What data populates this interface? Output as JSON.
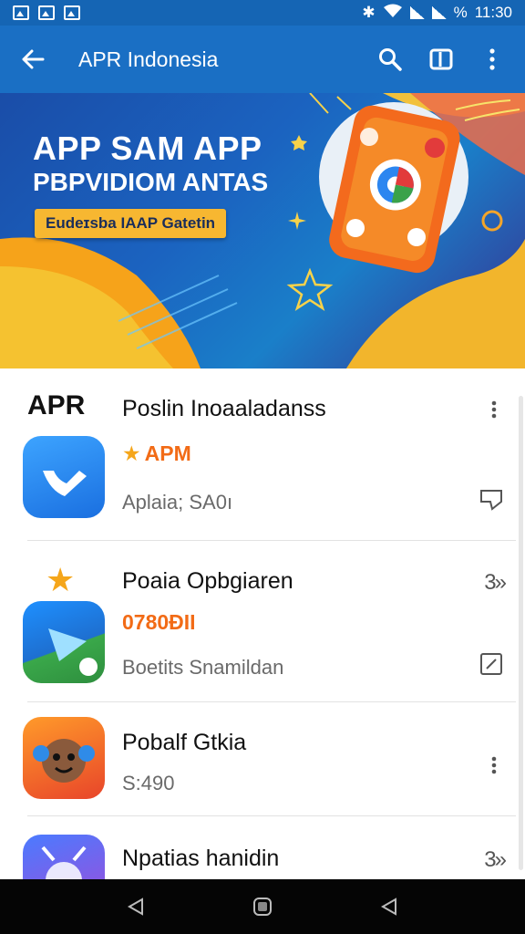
{
  "status_bar": {
    "time": "11:30",
    "battery": "%"
  },
  "app_bar": {
    "title": "APR Indonesia"
  },
  "banner": {
    "headline": "APP SAM APP",
    "subheadline": "PBPVIDIOM ANTAS",
    "badge": "Eudeɪsba IAAP Gatetin"
  },
  "list": {
    "brand_logo": "APR",
    "items": [
      {
        "title": "Poslin Inoaaladanss",
        "accent": "APM",
        "subtitle": "Aplaia; SA0ı"
      },
      {
        "title": "Poaia Opbgiaren",
        "accent": "0780ĐII",
        "subtitle": "Boetits Snamildan",
        "chevron": "3»"
      },
      {
        "title": "Pobalf Gtkia",
        "subtitle": "S:490"
      },
      {
        "title": "Npatias hanidin",
        "chevron": "3»"
      }
    ]
  },
  "colors": {
    "app_bar": "#1a6fc4",
    "status_bar": "#1565b4",
    "accent": "#f26b16",
    "badge": "#f7b731"
  }
}
